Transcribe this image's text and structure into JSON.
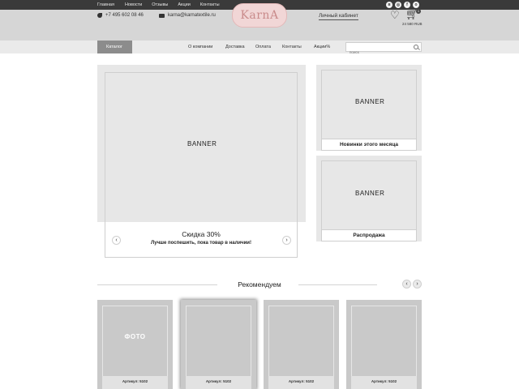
{
  "top_nav": [
    "Главная",
    "Новости",
    "Отзывы",
    "Акции",
    "Контакты"
  ],
  "social_icons": [
    "vk-icon",
    "instagram-icon",
    "facebook-icon",
    "odnoklassniki-icon"
  ],
  "header": {
    "phone": "+7 495 602 08 46",
    "email": "karna@karnatextile.ru",
    "logo": "KarnA",
    "account": "Личный кабинет",
    "cart_count": "1",
    "cart_sum": "24 580 RUB"
  },
  "menu": {
    "catalog": "Каталог",
    "items": [
      "О компании",
      "Доставка",
      "Оплата",
      "Контакты",
      "Акции%"
    ],
    "search_placeholder": "поиск"
  },
  "main_banner": {
    "label": "BANNER",
    "title": "Скидка 30%",
    "subtitle": "Лучше поспешить, пока товар в наличии!",
    "prev": "‹",
    "next": "›"
  },
  "side_banners": [
    {
      "label": "BANNER",
      "caption": "Новинки этого месяца"
    },
    {
      "label": "BANNER",
      "caption": "Распродажа"
    }
  ],
  "recommended": {
    "title": "Рекомендуем",
    "prev": "‹",
    "next": "›",
    "products": [
      {
        "photo": "ФОТО",
        "article": "Артикул: 5102"
      },
      {
        "photo": "",
        "article": "Артикул: 5102"
      },
      {
        "photo": "",
        "article": "Артикул: 5102"
      },
      {
        "photo": "",
        "article": "Артикул: 5102"
      }
    ]
  },
  "colors": {
    "top_bar": "#3a3a3a",
    "header_bg": "#d6d6d6",
    "logo_bg": "#f1d6d6",
    "logo_text": "#c98b8b",
    "catalog_bg": "#8c8c8c",
    "banner_bg": "#e7e7e7",
    "product_bg": "#c9c9c9"
  }
}
